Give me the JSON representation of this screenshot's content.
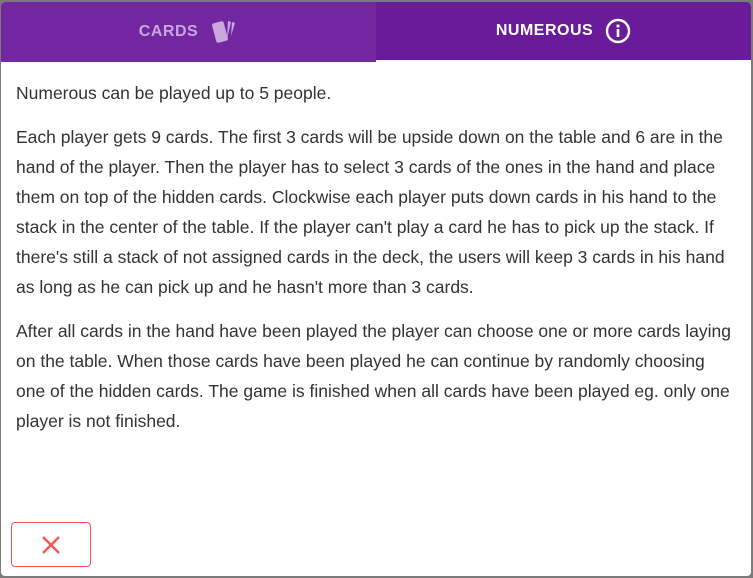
{
  "tabs": [
    {
      "label": "CARDS",
      "icon": "cards-icon",
      "active": false
    },
    {
      "label": "NUMEROUS",
      "icon": "info-icon",
      "active": true
    }
  ],
  "content": {
    "paragraphs": [
      "Numerous can be played up to 5 people.",
      "Each player gets 9 cards. The first 3 cards will be upside down on the table and 6 are in the hand of the player. Then the player has to select 3 cards of the ones in the hand and place them on top of the hidden cards. Clockwise each player puts down cards in his hand to the stack in the center of the table. If the player can't play a card he has to pick up the stack. If there's still a stack of not assigned cards in the deck, the users will keep 3 cards in his hand as long as he can pick up and he hasn't more than 3 cards.",
      "After all cards in the hand have been played the player can choose one or more cards laying on the table. When those cards have been played he can continue by randomly choosing one of the hidden cards. The game is finished when all cards have been played eg. only one player is not finished."
    ]
  },
  "close_button": {
    "icon": "close-icon"
  },
  "colors": {
    "tab_inactive": "#7227a0",
    "tab_active": "#6a1b9a",
    "close": "#ff5252"
  }
}
